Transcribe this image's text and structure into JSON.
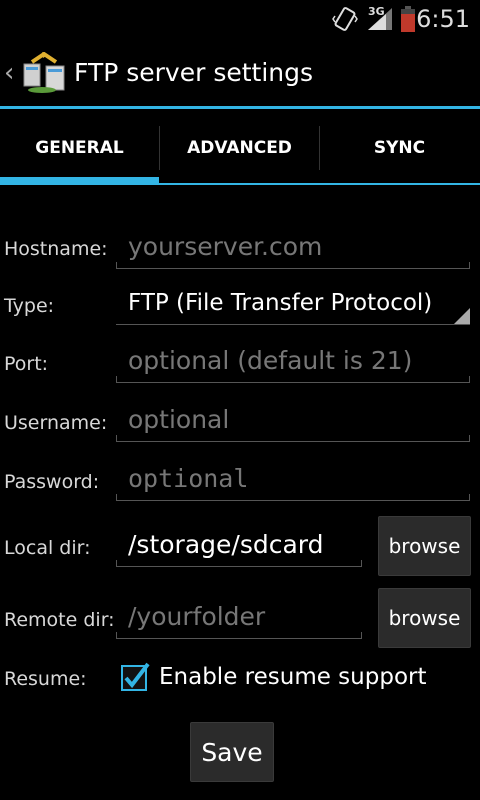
{
  "status_bar": {
    "network": "3G",
    "time": "6:51",
    "icons": [
      "vibrate-icon",
      "signal-icon",
      "battery-icon"
    ]
  },
  "action_bar": {
    "title": "FTP server settings",
    "up_icon": "chevron-left-icon",
    "app_icon": "ftp-app-icon"
  },
  "tabs": [
    {
      "label": "GENERAL",
      "selected": true
    },
    {
      "label": "ADVANCED",
      "selected": false
    },
    {
      "label": "SYNC",
      "selected": false
    }
  ],
  "form": {
    "hostname": {
      "label": "Hostname:",
      "placeholder": "yourserver.com",
      "value": ""
    },
    "type": {
      "label": "Type:",
      "value": "FTP (File Transfer Protocol)"
    },
    "port": {
      "label": "Port:",
      "placeholder": "optional (default is 21)",
      "value": ""
    },
    "username": {
      "label": "Username:",
      "placeholder": "optional",
      "value": ""
    },
    "password": {
      "label": "Password:",
      "placeholder": "optional",
      "value": ""
    },
    "local_dir": {
      "label": "Local dir:",
      "value": "/storage/sdcard",
      "browse_label": "browse"
    },
    "remote_dir": {
      "label": "Remote dir:",
      "placeholder": "/yourfolder",
      "value": "",
      "browse_label": "browse"
    },
    "resume": {
      "label": "Resume:",
      "checkbox_label": "Enable resume support",
      "checked": true
    }
  },
  "save_label": "Save",
  "colors": {
    "accent": "#33b5e5",
    "background": "#000000",
    "placeholder": "#777777"
  }
}
